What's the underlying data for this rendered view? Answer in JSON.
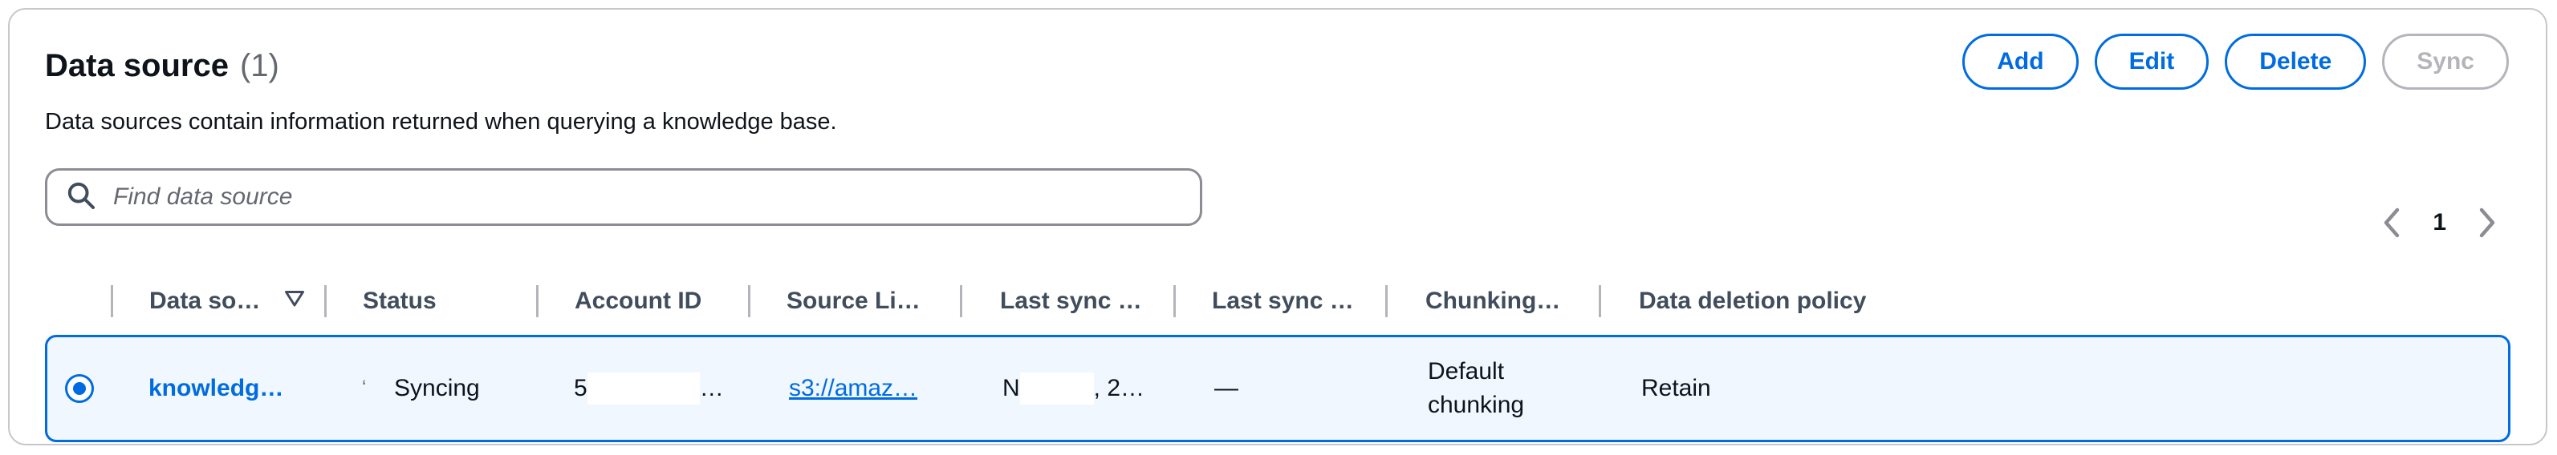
{
  "header": {
    "title": "Data source",
    "count": "(1)",
    "description": "Data sources contain information returned when querying a knowledge base."
  },
  "actions": {
    "add": "Add",
    "edit": "Edit",
    "delete": "Delete",
    "sync": "Sync"
  },
  "search": {
    "placeholder": "Find data source"
  },
  "pagination": {
    "current_page": "1"
  },
  "table": {
    "columns": [
      "Data so…",
      "Status",
      "Account ID",
      "Source Li…",
      "Last sync …",
      "Last sync …",
      "Chunking…",
      "Data deletion policy"
    ],
    "rows": [
      {
        "selected": true,
        "name": "knowledg…",
        "status_icon": "ʻ",
        "status": "Syncing",
        "account_prefix": "5",
        "account_suffix": "…",
        "source_link": "s3://amaz…",
        "last_sync_prefix": "N",
        "last_sync_suffix": ", 2…",
        "last_sync_status": "—",
        "chunking": "Default chunking",
        "deletion_policy": "Retain"
      }
    ]
  },
  "colors": {
    "accent": "#006ce0",
    "disabled": "#b4b4bb",
    "selected_row_bg": "#f0f7ff"
  },
  "icons": {
    "search": "search-icon",
    "sort": "sort-down-icon",
    "prev": "chevron-left-icon",
    "next": "chevron-right-icon"
  }
}
